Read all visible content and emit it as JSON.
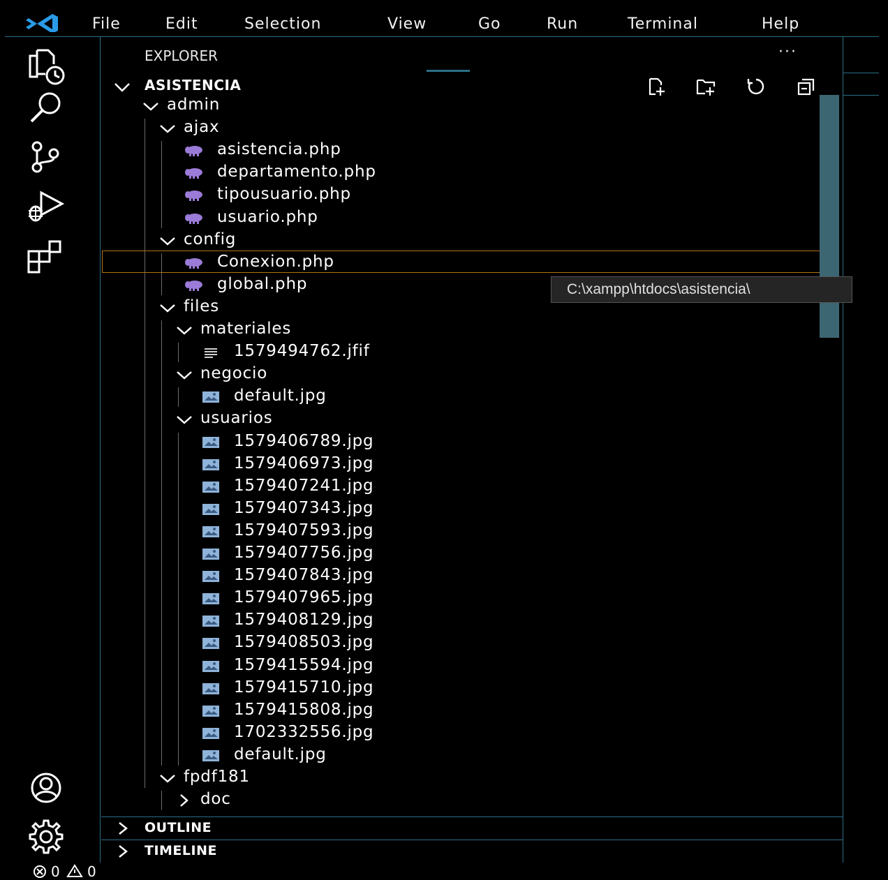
{
  "menu": {
    "items": [
      "File",
      "Edit",
      "Selection",
      "View",
      "Go",
      "Run",
      "Terminal",
      "Help"
    ]
  },
  "activity_bar": {
    "top": [
      "explorer-icon",
      "search-icon",
      "source-control-icon",
      "run-debug-icon",
      "extensions-icon"
    ],
    "bottom": [
      "accounts-icon",
      "settings-gear-icon"
    ]
  },
  "explorer": {
    "title": "EXPLORER",
    "more": "···",
    "root": "ASISTENCIA",
    "actions": [
      "new-file-icon",
      "new-folder-icon",
      "refresh-icon",
      "collapse-all-icon"
    ],
    "tree": [
      {
        "label": "admin",
        "kind": "folder",
        "expanded": true
      },
      {
        "label": "ajax",
        "kind": "folder",
        "expanded": true
      },
      {
        "label": "asistencia.php",
        "kind": "php"
      },
      {
        "label": "departamento.php",
        "kind": "php"
      },
      {
        "label": "tipousuario.php",
        "kind": "php"
      },
      {
        "label": "usuario.php",
        "kind": "php"
      },
      {
        "label": "config",
        "kind": "folder",
        "expanded": true
      },
      {
        "label": "Conexion.php",
        "kind": "php",
        "selected": true
      },
      {
        "label": "global.php",
        "kind": "php"
      },
      {
        "label": "files",
        "kind": "folder",
        "expanded": true
      },
      {
        "label": "materiales",
        "kind": "folder",
        "expanded": true
      },
      {
        "label": "1579494762.jfif",
        "kind": "text"
      },
      {
        "label": "negocio",
        "kind": "folder",
        "expanded": true
      },
      {
        "label": "default.jpg",
        "kind": "image"
      },
      {
        "label": "usuarios",
        "kind": "folder",
        "expanded": true
      },
      {
        "label": "1579406789.jpg",
        "kind": "image"
      },
      {
        "label": "1579406973.jpg",
        "kind": "image"
      },
      {
        "label": "1579407241.jpg",
        "kind": "image"
      },
      {
        "label": "1579407343.jpg",
        "kind": "image"
      },
      {
        "label": "1579407593.jpg",
        "kind": "image"
      },
      {
        "label": "1579407756.jpg",
        "kind": "image"
      },
      {
        "label": "1579407843.jpg",
        "kind": "image"
      },
      {
        "label": "1579407965.jpg",
        "kind": "image"
      },
      {
        "label": "1579408129.jpg",
        "kind": "image"
      },
      {
        "label": "1579408503.jpg",
        "kind": "image"
      },
      {
        "label": "1579415594.jpg",
        "kind": "image"
      },
      {
        "label": "1579415710.jpg",
        "kind": "image"
      },
      {
        "label": "1579415808.jpg",
        "kind": "image"
      },
      {
        "label": "1702332556.jpg",
        "kind": "image"
      },
      {
        "label": "default.jpg",
        "kind": "image"
      },
      {
        "label": "fpdf181",
        "kind": "folder",
        "expanded": true
      },
      {
        "label": "doc",
        "kind": "folder",
        "expanded": false
      }
    ],
    "tooltip": "C:\\xampp\\htdocs\\asistencia\\"
  },
  "panels": {
    "outline": "OUTLINE",
    "timeline": "TIMELINE"
  },
  "status": {
    "errors": "0",
    "warnings": "0"
  },
  "colors": {
    "accent_border": "#2b6f86",
    "selection_border": "#b5720d",
    "php_icon": "#9b7bd8",
    "image_icon": "#8fb3d9",
    "vscode_blue": "#2a9be8"
  }
}
